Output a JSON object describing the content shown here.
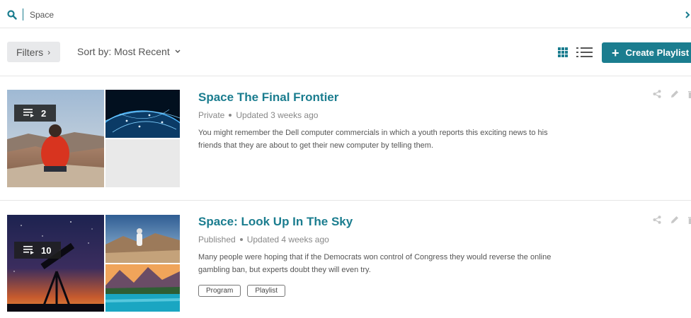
{
  "search": {
    "value": "Space"
  },
  "toolbar": {
    "filters_label": "Filters",
    "sort_label": "Sort by: Most Recent",
    "create_label": "Create Playlist"
  },
  "colors": {
    "accent": "#1b7d8f",
    "muted_text": "#888888",
    "filters_bg": "#e8e9eb"
  },
  "playlists": [
    {
      "title": "Space The Final Frontier",
      "status": "Private",
      "updated": "Updated 3 weeks ago",
      "count": "2",
      "description": "You might remember the Dell computer commercials in which a youth reports this exciting news to his friends that they are about to get their new computer by telling them.",
      "tags": []
    },
    {
      "title": "Space: Look Up In The Sky",
      "status": "Published",
      "updated": "Updated 4 weeks ago",
      "count": "10",
      "description": "Many people were hoping that if the Democrats won control of Congress they would reverse the online gambling ban, but experts doubt they will even try.",
      "tags": [
        "Program",
        "Playlist"
      ]
    }
  ],
  "icons": {
    "search": "search-icon",
    "next": "chevron-right-icon",
    "grid_view": "grid-view-icon",
    "list_view": "list-view-icon",
    "share": "share-icon",
    "edit": "edit-icon",
    "delete": "trash-icon",
    "playlist": "playlist-icon"
  }
}
